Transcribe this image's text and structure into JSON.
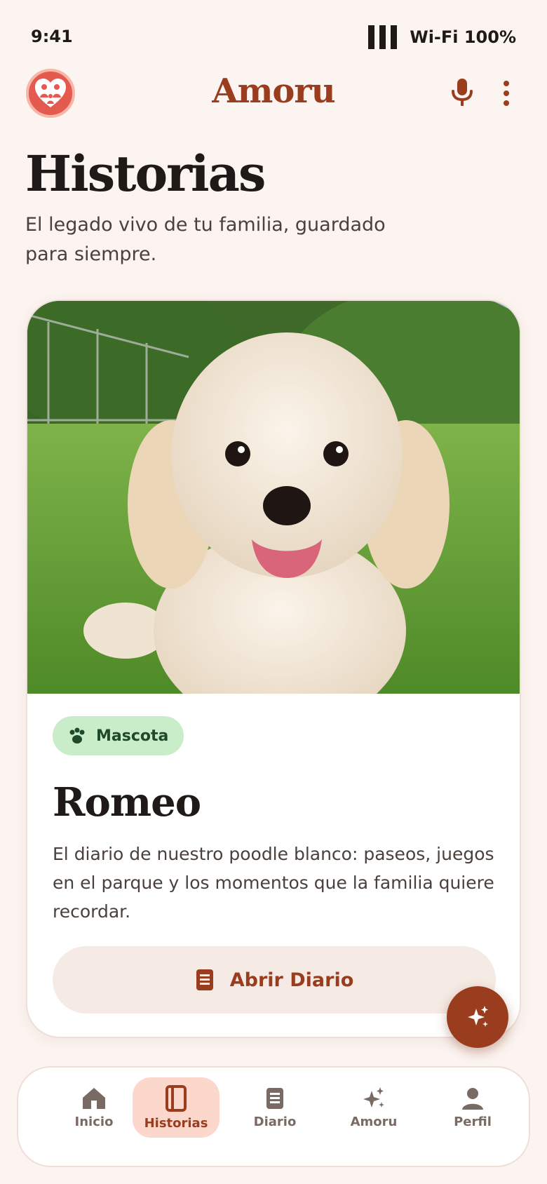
{
  "status_bar": {
    "time": "9:41",
    "connectivity": "Wi-Fi 100%"
  },
  "app_bar": {
    "title": "Amoru",
    "icons": [
      "family-heart-logo",
      "mic-icon",
      "more-vertical-icon"
    ]
  },
  "page": {
    "title": "Historias",
    "subtitle": "El legado vivo de tu familia, guardado para siempre."
  },
  "story_card": {
    "image": "photo of a white poodle lying on grass",
    "category": {
      "icon": "paw-icon",
      "label": "Mascota"
    },
    "title": "Romeo",
    "description": "El diario de nuestro poodle blanco: paseos, juegos en el parque y los momentos que la familia quiere recordar.",
    "button": {
      "icon": "book-icon",
      "label": "Abrir Diario"
    }
  },
  "fab": {
    "icon": "sparkles-icon"
  },
  "bottom_nav": {
    "items": [
      {
        "label": "Inicio",
        "icon": "home-icon",
        "active": false
      },
      {
        "label": "Historias",
        "icon": "book-open-icon",
        "active": true
      },
      {
        "label": "Diario",
        "icon": "journal-icon",
        "active": false
      },
      {
        "label": "Amoru",
        "icon": "sparkles-icon",
        "active": false
      },
      {
        "label": "Perfil",
        "icon": "person-icon",
        "active": false
      }
    ]
  },
  "colors": {
    "background": "#fcf4f0",
    "accent": "#9a3d1f",
    "chip": "#c9ecc9",
    "nav_active": "#fbd7cc"
  }
}
